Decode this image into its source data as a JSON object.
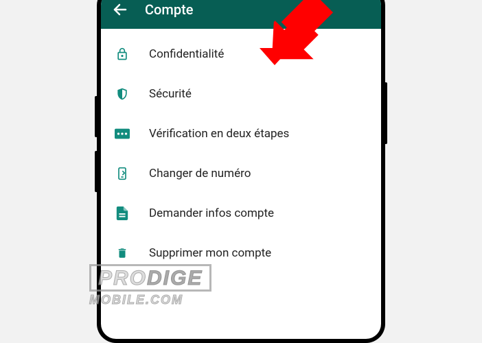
{
  "header": {
    "title": "Compte"
  },
  "menu": {
    "items": [
      {
        "icon": "lock-icon",
        "label": "Confidentialité"
      },
      {
        "icon": "shield-icon",
        "label": "Sécurité"
      },
      {
        "icon": "pin-icon",
        "label": "Vérification en deux étapes"
      },
      {
        "icon": "phone-change-icon",
        "label": "Changer de numéro"
      },
      {
        "icon": "document-icon",
        "label": "Demander infos compte"
      },
      {
        "icon": "trash-icon",
        "label": "Supprimer mon compte"
      }
    ]
  },
  "watermark": {
    "line1a": "PRO",
    "line1b": "DIGE",
    "line2": "MOBILE.COM"
  },
  "colors": {
    "appBar": "#075E54",
    "iconAccent": "#128C7E",
    "arrow": "#FF0000"
  }
}
